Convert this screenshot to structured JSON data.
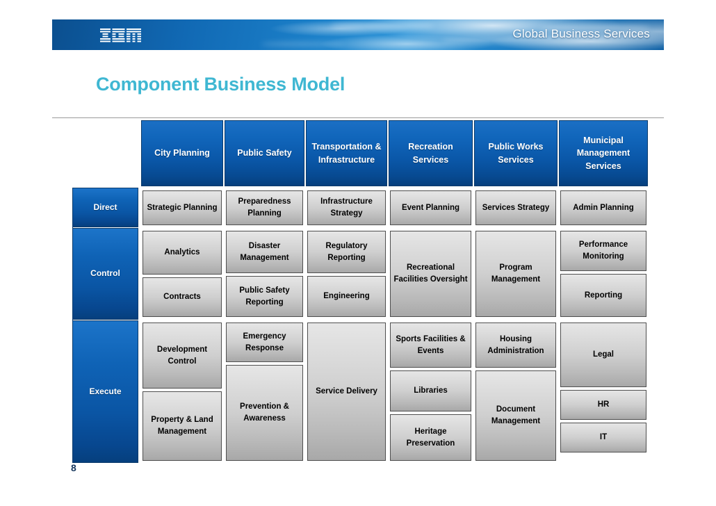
{
  "banner": {
    "brand_logo": "ibm-logo",
    "title": "Global Business Services"
  },
  "slide": {
    "title": "Component Business Model",
    "page_number": "8"
  },
  "colors": {
    "title_cyan": "#3FB7D2",
    "header_blue": "#0B57A8",
    "cell_gray": "#CFCFCF",
    "page_number": "#16365C"
  },
  "matrix": {
    "columns": [
      {
        "label": "City Planning"
      },
      {
        "label": "Public Safety"
      },
      {
        "label": "Transportation & Infrastructure"
      },
      {
        "label": "Recreation Services"
      },
      {
        "label": "Public Works Services"
      },
      {
        "label": "Municipal Management Services"
      }
    ],
    "rows": [
      {
        "label": "Direct"
      },
      {
        "label": "Control"
      },
      {
        "label": "Execute"
      }
    ],
    "components": [
      {
        "id": "c-strategic-planning",
        "label": "Strategic Planning",
        "row": "Direct",
        "column": "City Planning"
      },
      {
        "id": "c-preparedness-planning",
        "label": "Preparedness Planning",
        "row": "Direct",
        "column": "Public Safety"
      },
      {
        "id": "c-infrastructure-strategy",
        "label": "Infrastructure Strategy",
        "row": "Direct",
        "column": "Transportation & Infrastructure"
      },
      {
        "id": "c-event-planning",
        "label": "Event Planning",
        "row": "Direct",
        "column": "Recreation Services"
      },
      {
        "id": "c-services-strategy",
        "label": "Services Strategy",
        "row": "Direct",
        "column": "Public Works Services"
      },
      {
        "id": "c-admin-planning",
        "label": "Admin Planning",
        "row": "Direct",
        "column": "Municipal Management Services"
      },
      {
        "id": "c-analytics",
        "label": "Analytics",
        "row": "Control",
        "column": "City Planning"
      },
      {
        "id": "c-contracts",
        "label": "Contracts",
        "row": "Control",
        "column": "City Planning"
      },
      {
        "id": "c-disaster-management",
        "label": "Disaster Management",
        "row": "Control",
        "column": "Public Safety"
      },
      {
        "id": "c-public-safety-reporting",
        "label": "Public Safety Reporting",
        "row": "Control",
        "column": "Public Safety"
      },
      {
        "id": "c-regulatory-reporting",
        "label": "Regulatory Reporting",
        "row": "Control",
        "column": "Transportation & Infrastructure"
      },
      {
        "id": "c-engineering",
        "label": "Engineering",
        "row": "Control",
        "column": "Transportation & Infrastructure"
      },
      {
        "id": "c-recreational-facilities",
        "label": "Recreational Facilities Oversight",
        "row": "Control",
        "column": "Recreation Services"
      },
      {
        "id": "c-program-management",
        "label": "Program Management",
        "row": "Control",
        "column": "Public Works Services"
      },
      {
        "id": "c-performance-monitoring",
        "label": "Performance Monitoring",
        "row": "Control",
        "column": "Municipal Management Services"
      },
      {
        "id": "c-reporting",
        "label": "Reporting",
        "row": "Control",
        "column": "Municipal Management Services"
      },
      {
        "id": "c-development-control",
        "label": "Development Control",
        "row": "Execute",
        "column": "City Planning"
      },
      {
        "id": "c-property-land-management",
        "label": "Property & Land Management",
        "row": "Execute",
        "column": "City Planning"
      },
      {
        "id": "c-emergency-response",
        "label": "Emergency Response",
        "row": "Execute",
        "column": "Public Safety"
      },
      {
        "id": "c-prevention-awareness",
        "label": "Prevention & Awareness",
        "row": "Execute",
        "column": "Public Safety"
      },
      {
        "id": "c-service-delivery",
        "label": "Service Delivery",
        "row": "Execute",
        "column": "Transportation & Infrastructure"
      },
      {
        "id": "c-sports-facilities-events",
        "label": "Sports Facilities & Events",
        "row": "Execute",
        "column": "Recreation Services"
      },
      {
        "id": "c-libraries",
        "label": "Libraries",
        "row": "Execute",
        "column": "Recreation Services"
      },
      {
        "id": "c-heritage-preservation",
        "label": "Heritage Preservation",
        "row": "Execute",
        "column": "Recreation Services"
      },
      {
        "id": "c-housing-administration",
        "label": "Housing Administration",
        "row": "Execute",
        "column": "Public Works Services"
      },
      {
        "id": "c-document-management",
        "label": "Document Management",
        "row": "Execute",
        "column": "Public Works Services"
      },
      {
        "id": "c-legal",
        "label": "Legal",
        "row": "Execute",
        "column": "Municipal Management Services"
      },
      {
        "id": "c-hr",
        "label": "HR",
        "row": "Execute",
        "column": "Municipal Management Services"
      },
      {
        "id": "c-it",
        "label": "IT",
        "row": "Execute",
        "column": "Municipal Management Services"
      }
    ]
  }
}
